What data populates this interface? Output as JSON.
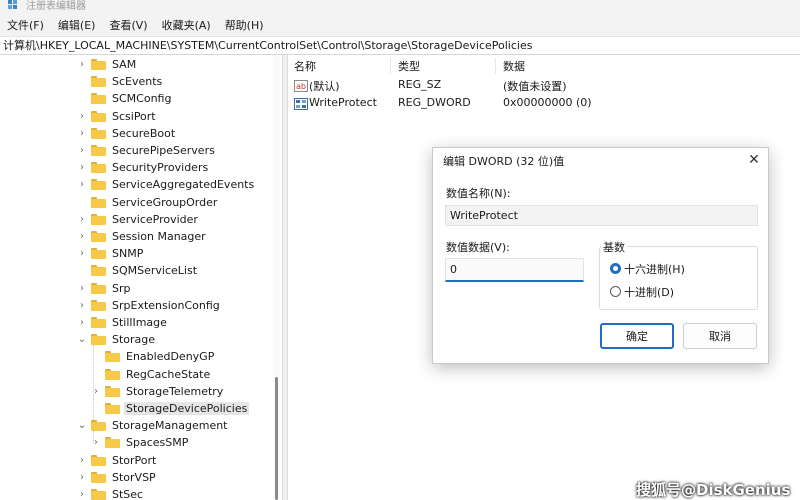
{
  "window": {
    "title": "注册表编辑器",
    "app_icon": "regedit-icon"
  },
  "menu": [
    "文件(F)",
    "编辑(E)",
    "查看(V)",
    "收藏夹(A)",
    "帮助(H)"
  ],
  "address": "计算机\\HKEY_LOCAL_MACHINE\\SYSTEM\\CurrentControlSet\\Control\\Storage\\StorageDevicePolicies",
  "tree": [
    {
      "label": "SAM",
      "expander": "›"
    },
    {
      "label": "ScEvents",
      "expander": ""
    },
    {
      "label": "SCMConfig",
      "expander": ""
    },
    {
      "label": "ScsiPort",
      "expander": "›"
    },
    {
      "label": "SecureBoot",
      "expander": "›"
    },
    {
      "label": "SecurePipeServers",
      "expander": "›"
    },
    {
      "label": "SecurityProviders",
      "expander": "›"
    },
    {
      "label": "ServiceAggregatedEvents",
      "expander": "›"
    },
    {
      "label": "ServiceGroupOrder",
      "expander": ""
    },
    {
      "label": "ServiceProvider",
      "expander": "›"
    },
    {
      "label": "Session Manager",
      "expander": "›"
    },
    {
      "label": "SNMP",
      "expander": "›"
    },
    {
      "label": "SQMServiceList",
      "expander": ""
    },
    {
      "label": "Srp",
      "expander": "›"
    },
    {
      "label": "SrpExtensionConfig",
      "expander": "›"
    },
    {
      "label": "StillImage",
      "expander": "›"
    },
    {
      "label": "Storage",
      "expander": "⌄"
    },
    {
      "label": "EnabledDenyGP",
      "expander": ""
    },
    {
      "label": "RegCacheState",
      "expander": ""
    },
    {
      "label": "StorageTelemetry",
      "expander": "›"
    },
    {
      "label": "StorageDevicePolicies",
      "expander": ""
    },
    {
      "label": "StorageManagement",
      "expander": "⌄"
    },
    {
      "label": "SpacesSMP",
      "expander": "›"
    },
    {
      "label": "StorPort",
      "expander": "›"
    },
    {
      "label": "StorVSP",
      "expander": "›"
    },
    {
      "label": "StSec",
      "expander": "›"
    }
  ],
  "list": {
    "headers": [
      "名称",
      "类型",
      "数据"
    ],
    "rows": [
      {
        "icon": "string-value-icon",
        "name": "(默认)",
        "type": "REG_SZ",
        "data": "(数值未设置)"
      },
      {
        "icon": "dword-value-icon",
        "name": "WriteProtect",
        "type": "REG_DWORD",
        "data": "0x00000000 (0)"
      }
    ]
  },
  "dialog": {
    "title": "编辑 DWORD (32 位)值",
    "name_label": "数值名称(N):",
    "name_value": "WriteProtect",
    "data_label": "数值数据(V):",
    "data_value": "0",
    "base_label": "基数",
    "base_options": [
      {
        "label": "十六进制(H)",
        "checked": true
      },
      {
        "label": "十进制(D)",
        "checked": false
      }
    ],
    "ok": "确定",
    "cancel": "取消"
  },
  "watermark": "搜狐号@DiskGenius",
  "colors": {
    "accent": "#1f6fc0",
    "folder": "#f7c948",
    "selection": "#e5e5e5"
  }
}
